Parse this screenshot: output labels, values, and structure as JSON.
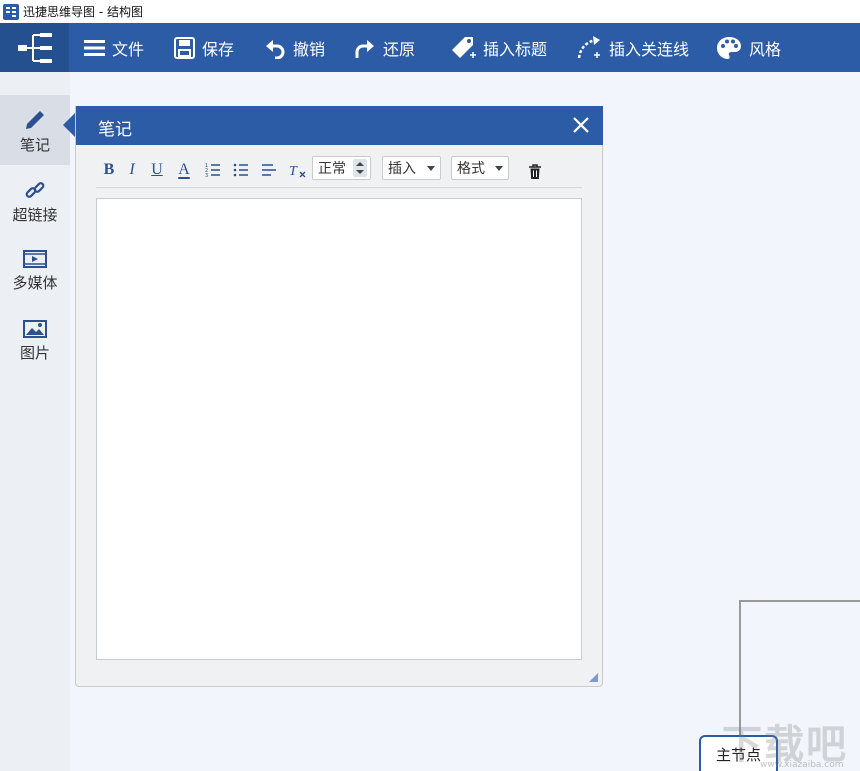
{
  "window": {
    "title": "迅捷思维导图 - 结构图"
  },
  "toolbar": {
    "items": [
      {
        "label": "文件",
        "icon": "menu-icon"
      },
      {
        "label": "保存",
        "icon": "save-icon"
      },
      {
        "label": "撤销",
        "icon": "undo-icon"
      },
      {
        "label": "还原",
        "icon": "redo-icon"
      },
      {
        "label": "插入标题",
        "icon": "tag-icon"
      },
      {
        "label": "插入关连线",
        "icon": "link-line-icon"
      },
      {
        "label": "风格",
        "icon": "palette-icon"
      }
    ],
    "colors": {
      "bar": "#2d5ca6",
      "logo_bg": "#24508f"
    }
  },
  "left_panel": {
    "items": [
      {
        "label": "笔记",
        "icon": "pencil-icon",
        "active": true
      },
      {
        "label": "超链接",
        "icon": "link-icon",
        "active": false
      },
      {
        "label": "多媒体",
        "icon": "video-icon",
        "active": false
      },
      {
        "label": "图片",
        "icon": "image-icon",
        "active": false
      }
    ]
  },
  "note_dialog": {
    "title": "笔记",
    "format_buttons": [
      "B",
      "I",
      "U",
      "A"
    ],
    "list_icons": [
      "ordered-list-icon",
      "bullet-list-icon",
      "align-icon",
      "clear-format-icon"
    ],
    "style_select": "正常",
    "insert_select": "插入",
    "format_select": "格式",
    "content": ""
  },
  "canvas": {
    "main_node": "主节点",
    "watermark": "下载吧",
    "watermark_sub": "www.xiazaiba.com"
  }
}
